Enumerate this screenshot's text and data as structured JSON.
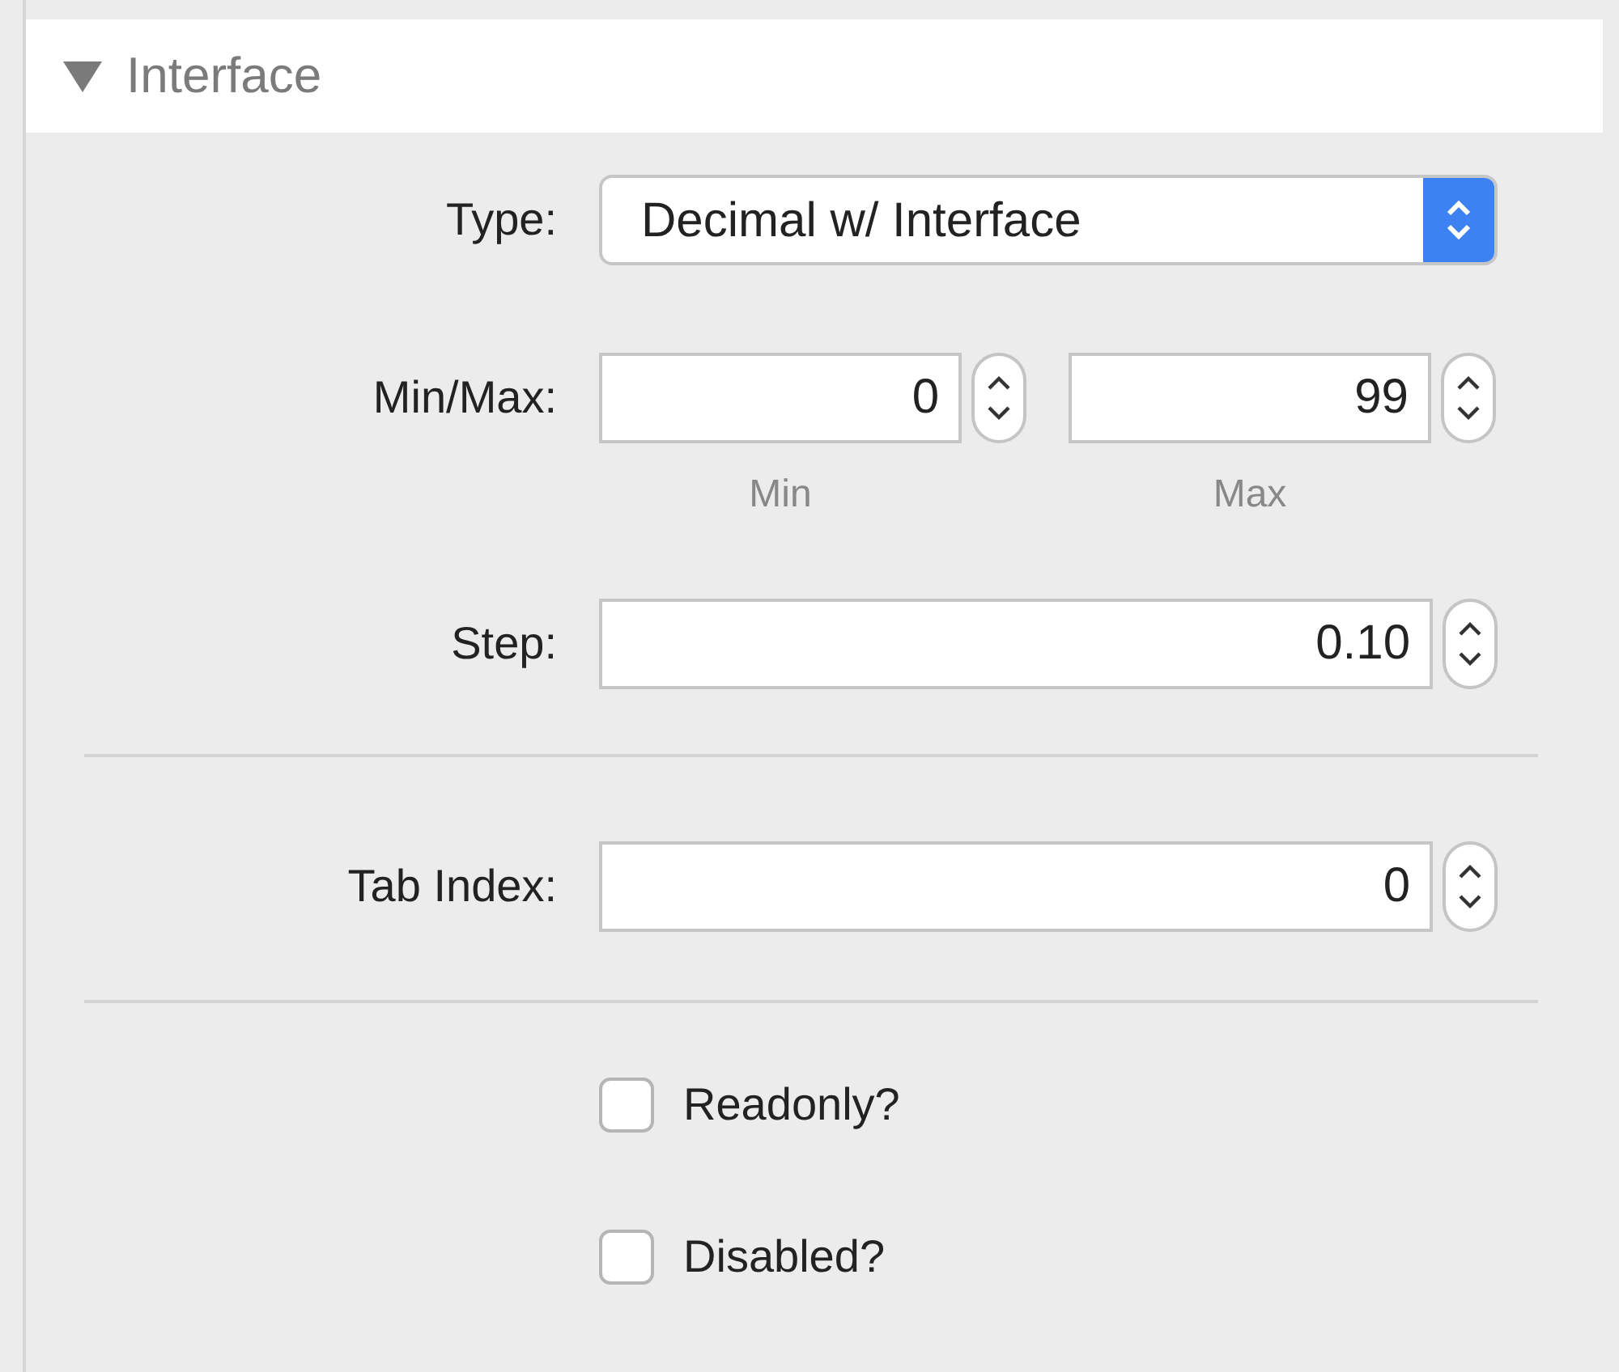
{
  "section": {
    "title": "Interface",
    "expanded": true
  },
  "type": {
    "label": "Type:",
    "value": "Decimal w/ Interface"
  },
  "min_max": {
    "label": "Min/Max:",
    "min": {
      "value": "0",
      "caption": "Min"
    },
    "max": {
      "value": "99",
      "caption": "Max"
    }
  },
  "step": {
    "label": "Step:",
    "value": "0.10"
  },
  "tab_index": {
    "label": "Tab Index:",
    "value": "0"
  },
  "checkboxes": [
    {
      "label": "Readonly?",
      "checked": false
    },
    {
      "label": "Disabled?",
      "checked": false
    }
  ]
}
